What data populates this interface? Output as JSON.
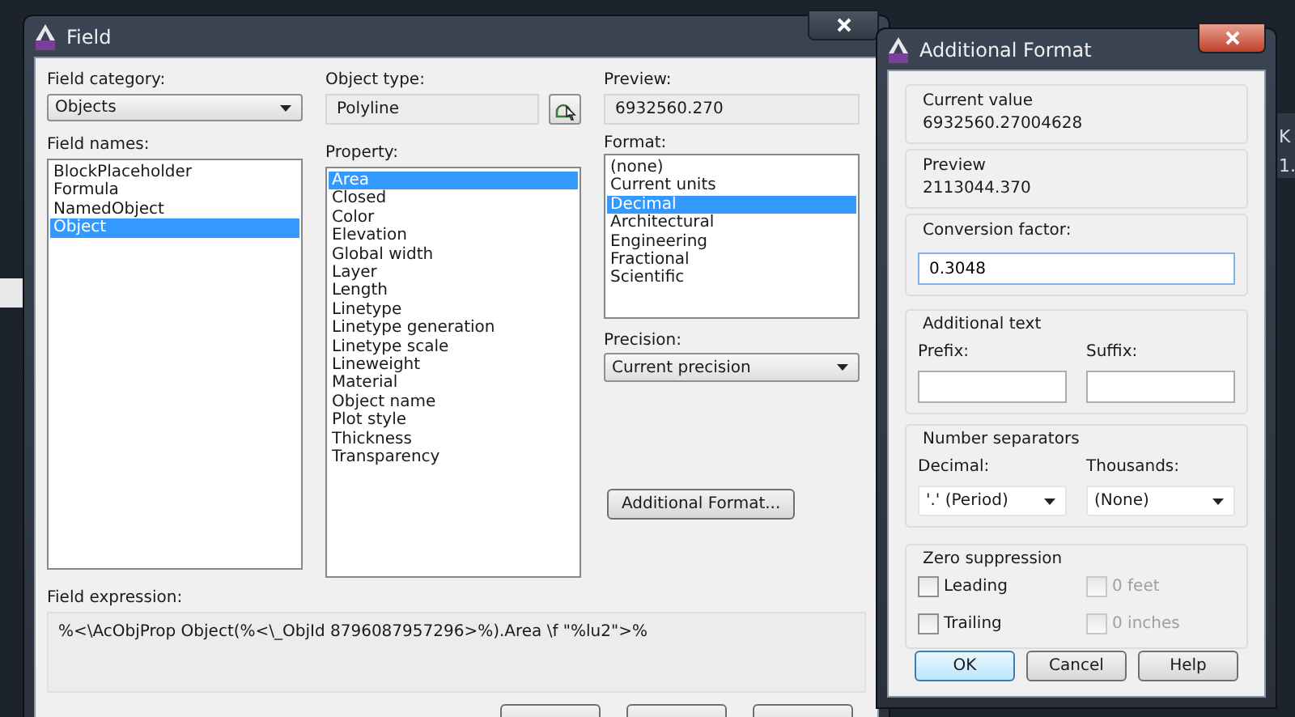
{
  "background": {
    "fragments": [
      "K",
      "1."
    ]
  },
  "field_dialog": {
    "title": "Field",
    "field_category": {
      "label": "Field category:",
      "value": "Objects"
    },
    "field_names": {
      "label": "Field names:",
      "items": [
        {
          "label": "BlockPlaceholder",
          "selected": false
        },
        {
          "label": "Formula",
          "selected": false
        },
        {
          "label": "NamedObject",
          "selected": false
        },
        {
          "label": "Object",
          "selected": true
        }
      ]
    },
    "object_type": {
      "label": "Object type:",
      "value": "Polyline"
    },
    "property": {
      "label": "Property:",
      "items": [
        {
          "label": "Area",
          "selected": true
        },
        {
          "label": "Closed",
          "selected": false
        },
        {
          "label": "Color",
          "selected": false
        },
        {
          "label": "Elevation",
          "selected": false
        },
        {
          "label": "Global width",
          "selected": false
        },
        {
          "label": "Layer",
          "selected": false
        },
        {
          "label": "Length",
          "selected": false
        },
        {
          "label": "Linetype",
          "selected": false
        },
        {
          "label": "Linetype generation",
          "selected": false
        },
        {
          "label": "Linetype scale",
          "selected": false
        },
        {
          "label": "Lineweight",
          "selected": false
        },
        {
          "label": "Material",
          "selected": false
        },
        {
          "label": "Object name",
          "selected": false
        },
        {
          "label": "Plot style",
          "selected": false
        },
        {
          "label": "Thickness",
          "selected": false
        },
        {
          "label": "Transparency",
          "selected": false
        }
      ]
    },
    "preview": {
      "label": "Preview:",
      "value": "6932560.270"
    },
    "format": {
      "label": "Format:",
      "items": [
        {
          "label": "(none)",
          "selected": false
        },
        {
          "label": "Current units",
          "selected": false
        },
        {
          "label": "Decimal",
          "selected": true
        },
        {
          "label": "Architectural",
          "selected": false
        },
        {
          "label": "Engineering",
          "selected": false
        },
        {
          "label": "Fractional",
          "selected": false
        },
        {
          "label": "Scientific",
          "selected": false
        }
      ]
    },
    "precision": {
      "label": "Precision:",
      "value": "Current precision"
    },
    "additional_format_button": "Additional Format...",
    "field_expression": {
      "label": "Field expression:",
      "value": "%<\\AcObjProp Object(%<\\_ObjId 8796087957296>%).Area \\f \"%lu2\">%"
    }
  },
  "additional_format": {
    "title": "Additional Format",
    "current_value": {
      "label": "Current value",
      "value": "6932560.27004628"
    },
    "preview": {
      "label": "Preview",
      "value": "2113044.370"
    },
    "conversion_factor": {
      "label": "Conversion factor:",
      "value": "0.3048"
    },
    "additional_text": {
      "label": "Additional text",
      "prefix": {
        "label": "Prefix:"
      },
      "suffix": {
        "label": "Suffix:"
      }
    },
    "number_separators": {
      "label": "Number separators",
      "decimal": {
        "label": "Decimal:",
        "value": "'.' (Period)"
      },
      "thousands": {
        "label": "Thousands:",
        "value": "(None)"
      }
    },
    "zero_suppression": {
      "label": "Zero suppression",
      "options": [
        {
          "label": "Leading",
          "checked": false,
          "disabled": false
        },
        {
          "label": "0 feet",
          "checked": false,
          "disabled": true
        },
        {
          "label": "Trailing",
          "checked": false,
          "disabled": false
        },
        {
          "label": "0 inches",
          "checked": false,
          "disabled": true
        }
      ]
    },
    "buttons": [
      {
        "label": "OK",
        "default": true
      },
      {
        "label": "Cancel",
        "default": false
      },
      {
        "label": "Help",
        "default": false
      }
    ]
  }
}
